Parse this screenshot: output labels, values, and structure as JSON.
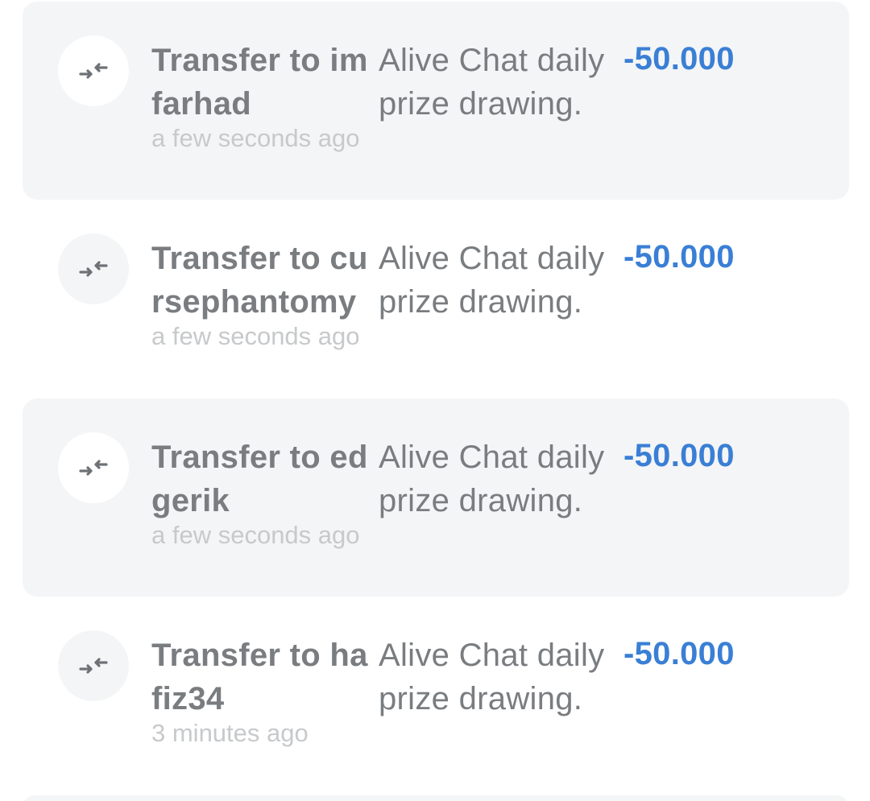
{
  "transactions": [
    {
      "icon": "transfer-arrows-icon",
      "title": "Transfer to imfarhad",
      "time": "a few seconds ago",
      "description": "Alive Chat daily prize drawing.",
      "amount": "-50.000"
    },
    {
      "icon": "transfer-arrows-icon",
      "title": "Transfer to cursephantomy",
      "time": "a few seconds ago",
      "description": "Alive Chat daily prize drawing.",
      "amount": "-50.000"
    },
    {
      "icon": "transfer-arrows-icon",
      "title": "Transfer to edgerik",
      "time": "a few seconds ago",
      "description": "Alive Chat daily prize drawing.",
      "amount": "-50.000"
    },
    {
      "icon": "transfer-arrows-icon",
      "title": "Transfer to hafiz34",
      "time": "3 minutes ago",
      "description": "Alive Chat daily prize drawing.",
      "amount": "-50.000"
    }
  ],
  "colors": {
    "amount": "#3a7fd5",
    "text": "#7a7d80",
    "time": "#c7c9cb",
    "row_shade": "#f4f5f6"
  }
}
